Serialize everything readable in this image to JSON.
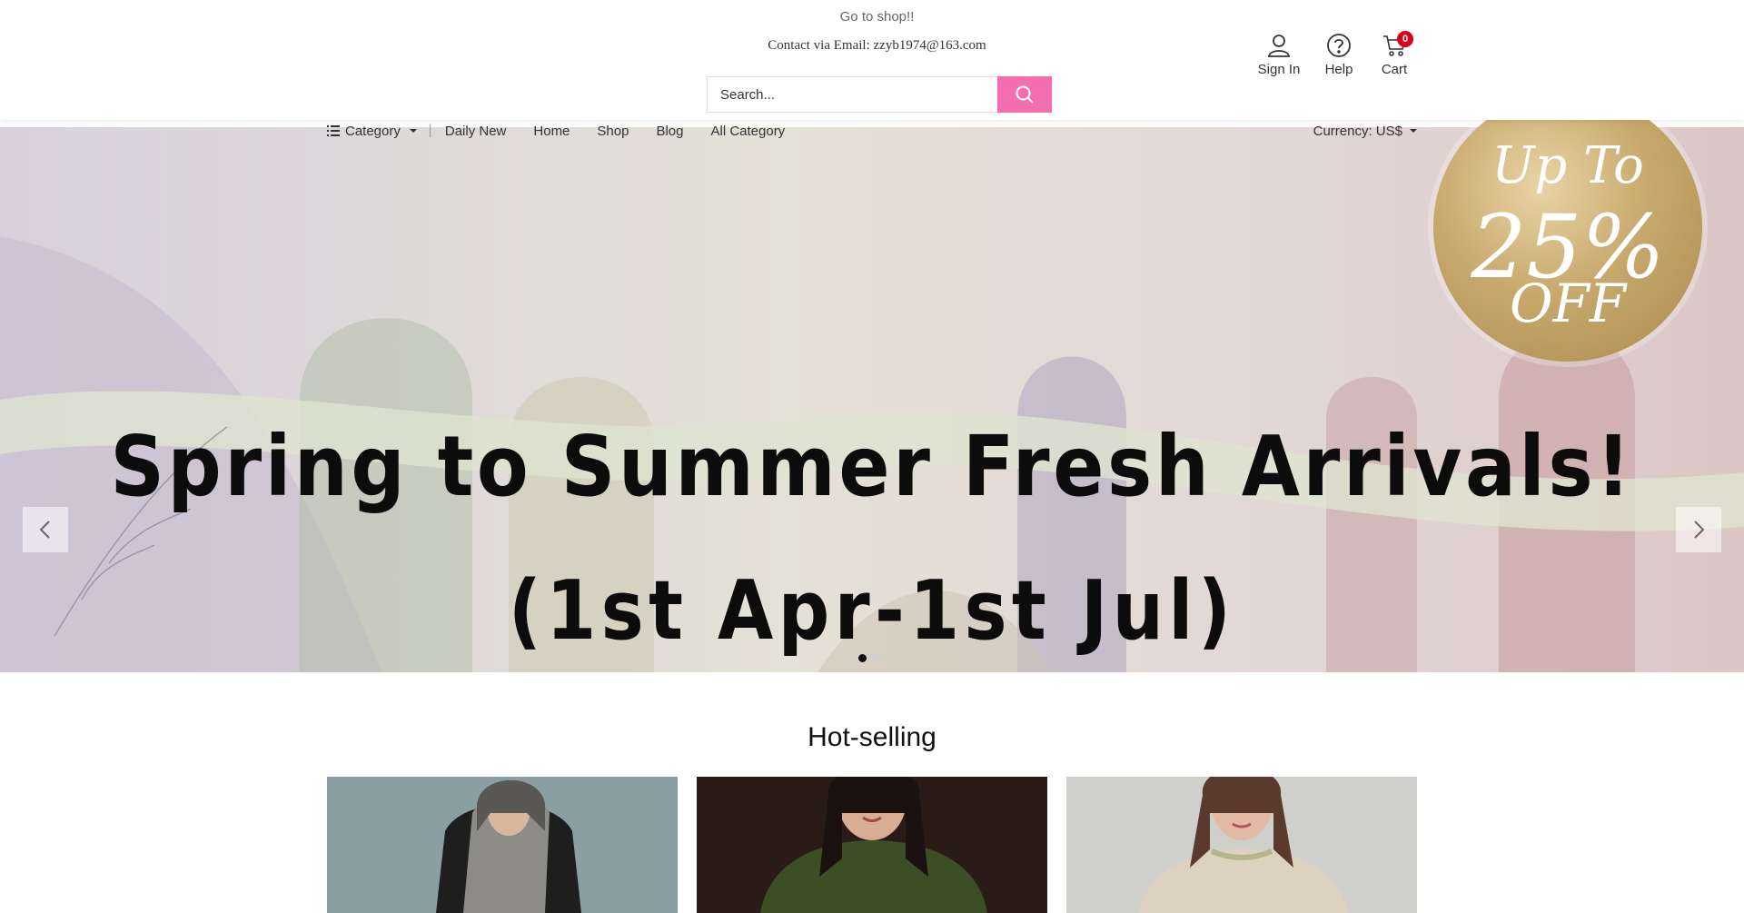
{
  "header": {
    "tagline": "Go to shop!!",
    "contact": "Contact via Email: zzyb1974@163.com",
    "search_placeholder": "Search...",
    "tools": {
      "signin": "Sign In",
      "help": "Help",
      "cart": "Cart",
      "cart_count": "0"
    }
  },
  "nav": {
    "category": "Category",
    "links": [
      "Daily New",
      "Home",
      "Shop",
      "Blog",
      "All Category"
    ],
    "currency": "Currency: US$"
  },
  "banner": {
    "headline": "Spring to Summer Fresh Arrivals!",
    "subline": "(1st Apr-1st Jul)",
    "badge": {
      "top": "Up To",
      "mid": "25%",
      "bot": "OFF"
    },
    "slides_total": 2,
    "active_slide": 1
  },
  "products": {
    "title": "Hot-selling"
  },
  "colors": {
    "accent": "#f56fb0",
    "badge_red": "#d9001b"
  }
}
